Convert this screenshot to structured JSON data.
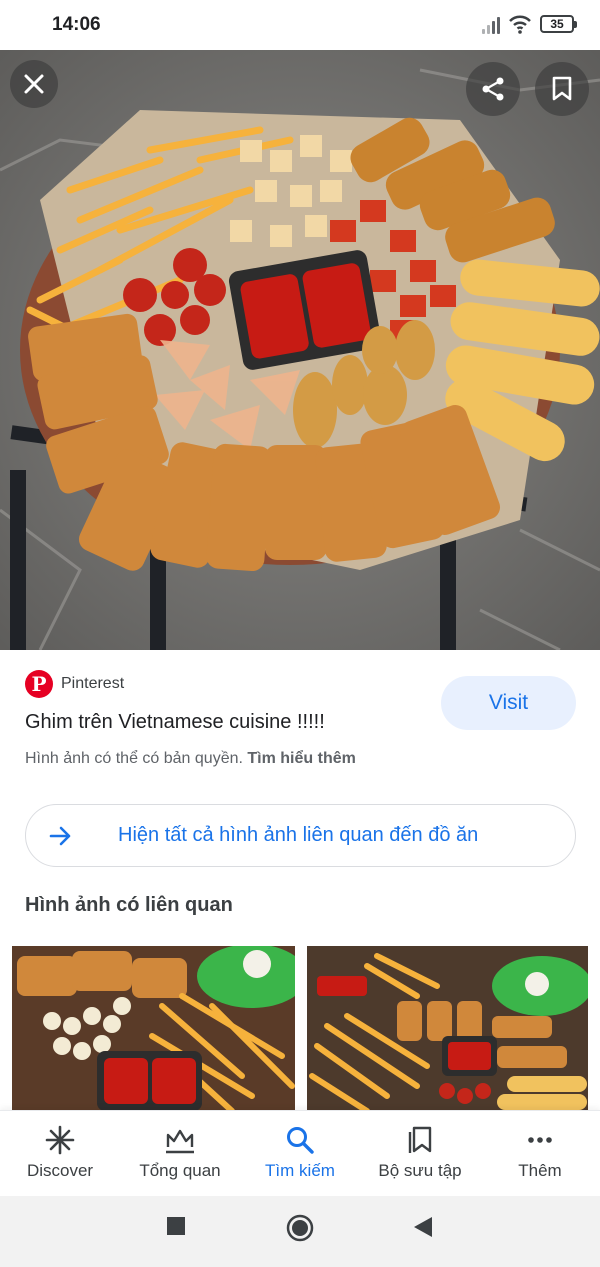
{
  "status_bar": {
    "time": "14:06",
    "battery": "35"
  },
  "result": {
    "source": "Pinterest",
    "title": "Ghim trên Vietnamese cuisine !!!!!",
    "visit_label": "Visit",
    "copyright_text": "Hình ảnh có thể có bản quyền.",
    "learn_more": "Tìm hiểu thêm"
  },
  "related_link": {
    "label": "Hiện tất cả hình ảnh liên quan đến đồ ăn"
  },
  "related_section": {
    "title": "Hình ảnh có liên quan"
  },
  "bottom_nav": {
    "items": [
      {
        "label": "Discover",
        "icon": "asterisk-icon"
      },
      {
        "label": "Tổng quan",
        "icon": "crown-tray-icon"
      },
      {
        "label": "Tìm kiếm",
        "icon": "search-icon",
        "active": true
      },
      {
        "label": "Bộ sưu tập",
        "icon": "collections-icon"
      },
      {
        "label": "Thêm",
        "icon": "more-dots-icon"
      }
    ]
  },
  "colors": {
    "accent": "#1a73e8",
    "pinterest": "#e60023",
    "visit_bg": "#e8f0fe"
  }
}
